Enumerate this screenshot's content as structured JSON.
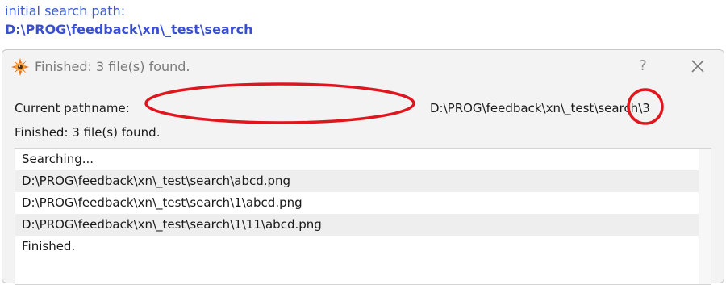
{
  "header": {
    "label": "initial search path:",
    "path": "D:\\PROG\\feedback\\xn\\_test\\search"
  },
  "dialog": {
    "title": "Finished: 3 file(s) found.",
    "help_glyph": "?",
    "close_icon": "close-icon",
    "app_icon": "xnview-eye-icon",
    "current_pathname_label": "Current pathname:",
    "current_pathname_value": "D:\\PROG\\feedback\\xn\\_test\\search\\3",
    "status": "Finished: 3 file(s) found.",
    "log": [
      "Searching...",
      "D:\\PROG\\feedback\\xn\\_test\\search\\abcd.png",
      "D:\\PROG\\feedback\\xn\\_test\\search\\1\\abcd.png",
      "D:\\PROG\\feedback\\xn\\_test\\search\\1\\11\\abcd.png",
      "Finished."
    ]
  },
  "colors": {
    "annotation_red": "#e0161e",
    "header_blue": "#3b5bd6"
  }
}
